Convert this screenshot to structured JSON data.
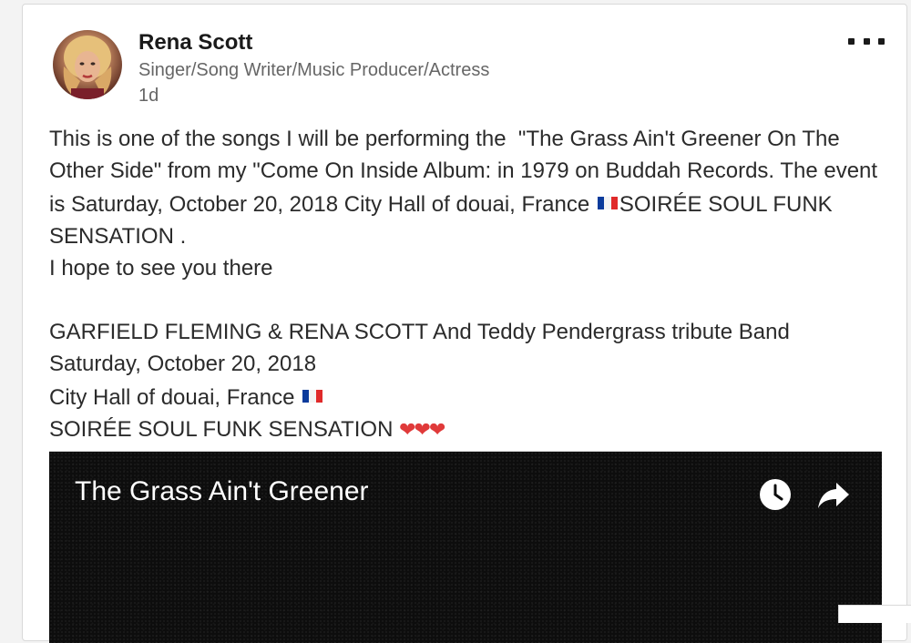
{
  "post": {
    "author": {
      "name": "Rena Scott",
      "headline": "Singer/Song Writer/Music Producer/Actress",
      "time": "1d"
    },
    "more_icon": "more-horizontal-icon",
    "body": {
      "line1": "This is one of the songs I will be performing the  \"The Grass Ain't Greener On The Other Side\" from my \"Come On Inside Album: in 1979 on Buddah Records. The event is Saturday, October 20, 2018 City Hall of douai, France ",
      "line1b": "SOIRÉE SOUL FUNK SENSATION .",
      "line2": "I hope to see you there",
      "line3": "GARFIELD FLEMING & RENA SCOTT And Teddy Pendergrass tribute Band",
      "line4": "Saturday, October 20, 2018",
      "line5": "City Hall of douai, France ",
      "line6": "SOIRÉE SOUL FUNK SENSATION ",
      "hearts": "❤❤❤"
    },
    "video": {
      "title": "The Grass Ain't Greener",
      "icons": [
        "clock-icon",
        "share-arrow-icon"
      ]
    },
    "colors": {
      "flag_blue": "#0b3b9c",
      "flag_white": "#ffffff",
      "flag_red": "#e02a2a",
      "heart": "#e03a3a"
    }
  }
}
